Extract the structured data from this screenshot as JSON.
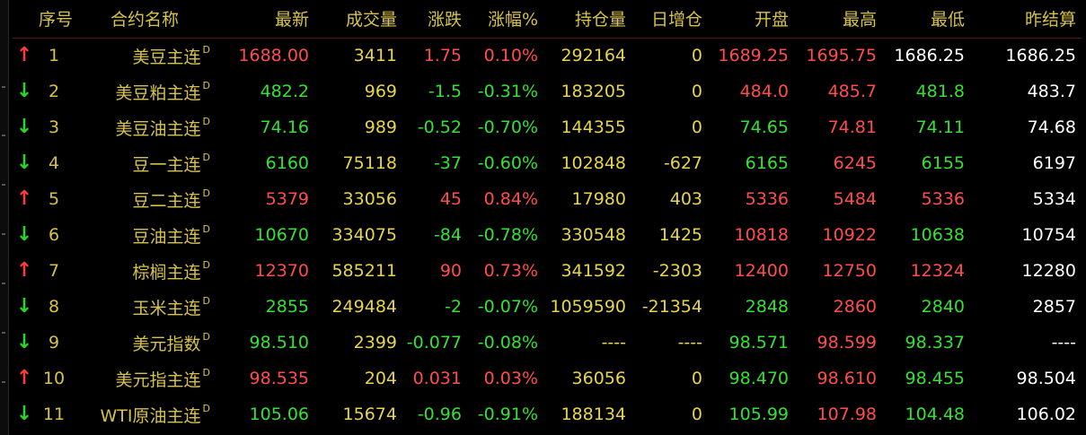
{
  "headers": {
    "seq": "序号",
    "name": "合约名称",
    "last": "最新",
    "volume": "成交量",
    "change": "涨跌",
    "pct": "涨幅%",
    "oi": "持仓量",
    "oi_chg": "日增仓",
    "open": "开盘",
    "high": "最高",
    "low": "最低",
    "prev": "昨结算"
  },
  "colors": {
    "up": "#ff4d4d",
    "down": "#34e134",
    "flat": "#ffffff",
    "label": "#d6c24a"
  },
  "rows": [
    {
      "dir": "up",
      "arrow": "↑",
      "seq": "1",
      "name": "美豆主连",
      "flag": "D",
      "last": "1688.00",
      "last_c": "red",
      "volume": "3411",
      "change": "1.75",
      "change_c": "red",
      "pct": "0.10%",
      "pct_c": "red",
      "oi": "292164",
      "oi_chg": "0",
      "open": "1689.25",
      "open_c": "red",
      "high": "1695.75",
      "high_c": "red",
      "low": "1686.25",
      "low_c": "white",
      "prev": "1686.25"
    },
    {
      "dir": "down",
      "arrow": "↓",
      "seq": "2",
      "name": "美豆粕主连",
      "flag": "D",
      "last": "482.2",
      "last_c": "green",
      "volume": "969",
      "change": "-1.5",
      "change_c": "green",
      "pct": "-0.31%",
      "pct_c": "green",
      "oi": "183205",
      "oi_chg": "0",
      "open": "484.0",
      "open_c": "red",
      "high": "485.7",
      "high_c": "red",
      "low": "481.8",
      "low_c": "green",
      "prev": "483.7"
    },
    {
      "dir": "down",
      "arrow": "↓",
      "seq": "3",
      "name": "美豆油主连",
      "flag": "D",
      "last": "74.16",
      "last_c": "green",
      "volume": "989",
      "change": "-0.52",
      "change_c": "green",
      "pct": "-0.70%",
      "pct_c": "green",
      "oi": "144355",
      "oi_chg": "0",
      "open": "74.65",
      "open_c": "green",
      "high": "74.81",
      "high_c": "red",
      "low": "74.11",
      "low_c": "green",
      "prev": "74.68"
    },
    {
      "dir": "down",
      "arrow": "↓",
      "seq": "4",
      "name": "豆一主连",
      "flag": "D",
      "last": "6160",
      "last_c": "green",
      "volume": "75118",
      "change": "-37",
      "change_c": "green",
      "pct": "-0.60%",
      "pct_c": "green",
      "oi": "102848",
      "oi_chg": "-627",
      "open": "6165",
      "open_c": "green",
      "high": "6245",
      "high_c": "red",
      "low": "6155",
      "low_c": "green",
      "prev": "6197"
    },
    {
      "dir": "up",
      "arrow": "↑",
      "seq": "5",
      "name": "豆二主连",
      "flag": "D",
      "last": "5379",
      "last_c": "red",
      "volume": "33056",
      "change": "45",
      "change_c": "red",
      "pct": "0.84%",
      "pct_c": "red",
      "oi": "17980",
      "oi_chg": "403",
      "open": "5336",
      "open_c": "red",
      "high": "5484",
      "high_c": "red",
      "low": "5336",
      "low_c": "red",
      "prev": "5334"
    },
    {
      "dir": "down",
      "arrow": "↓",
      "seq": "6",
      "name": "豆油主连",
      "flag": "D",
      "last": "10670",
      "last_c": "green",
      "volume": "334075",
      "change": "-84",
      "change_c": "green",
      "pct": "-0.78%",
      "pct_c": "green",
      "oi": "330548",
      "oi_chg": "1425",
      "open": "10818",
      "open_c": "red",
      "high": "10922",
      "high_c": "red",
      "low": "10638",
      "low_c": "green",
      "prev": "10754"
    },
    {
      "dir": "up",
      "arrow": "↑",
      "seq": "7",
      "name": "棕榈主连",
      "flag": "D",
      "last": "12370",
      "last_c": "red",
      "volume": "585211",
      "change": "90",
      "change_c": "red",
      "pct": "0.73%",
      "pct_c": "red",
      "oi": "341592",
      "oi_chg": "-2303",
      "open": "12400",
      "open_c": "red",
      "high": "12750",
      "high_c": "red",
      "low": "12324",
      "low_c": "red",
      "prev": "12280"
    },
    {
      "dir": "down",
      "arrow": "↓",
      "seq": "8",
      "name": "玉米主连",
      "flag": "D",
      "last": "2855",
      "last_c": "green",
      "volume": "249484",
      "change": "-2",
      "change_c": "green",
      "pct": "-0.07%",
      "pct_c": "green",
      "oi": "1059590",
      "oi_chg": "-21354",
      "open": "2848",
      "open_c": "green",
      "high": "2860",
      "high_c": "red",
      "low": "2840",
      "low_c": "green",
      "prev": "2857"
    },
    {
      "dir": "down",
      "arrow": "↓",
      "seq": "9",
      "name": "美元指数",
      "flag": "D",
      "last": "98.510",
      "last_c": "green",
      "volume": "2399",
      "change": "-0.077",
      "change_c": "green",
      "pct": "-0.08%",
      "pct_c": "green",
      "oi": "----",
      "oi_chg": "----",
      "open": "98.571",
      "open_c": "green",
      "high": "98.599",
      "high_c": "red",
      "low": "98.337",
      "low_c": "green",
      "prev": "----"
    },
    {
      "dir": "up",
      "arrow": "↑",
      "seq": "10",
      "name": "美元指主连",
      "flag": "D",
      "last": "98.535",
      "last_c": "red",
      "volume": "204",
      "change": "0.031",
      "change_c": "red",
      "pct": "0.03%",
      "pct_c": "red",
      "oi": "36056",
      "oi_chg": "0",
      "open": "98.470",
      "open_c": "green",
      "high": "98.610",
      "high_c": "red",
      "low": "98.455",
      "low_c": "green",
      "prev": "98.504"
    },
    {
      "dir": "down",
      "arrow": "↓",
      "seq": "11",
      "name": "WTI原油主连",
      "flag": "D",
      "last": "105.06",
      "last_c": "green",
      "volume": "15674",
      "change": "-0.96",
      "change_c": "green",
      "pct": "-0.91%",
      "pct_c": "green",
      "oi": "188134",
      "oi_chg": "0",
      "open": "105.99",
      "open_c": "green",
      "high": "107.98",
      "high_c": "red",
      "low": "104.48",
      "low_c": "green",
      "prev": "106.02"
    }
  ]
}
